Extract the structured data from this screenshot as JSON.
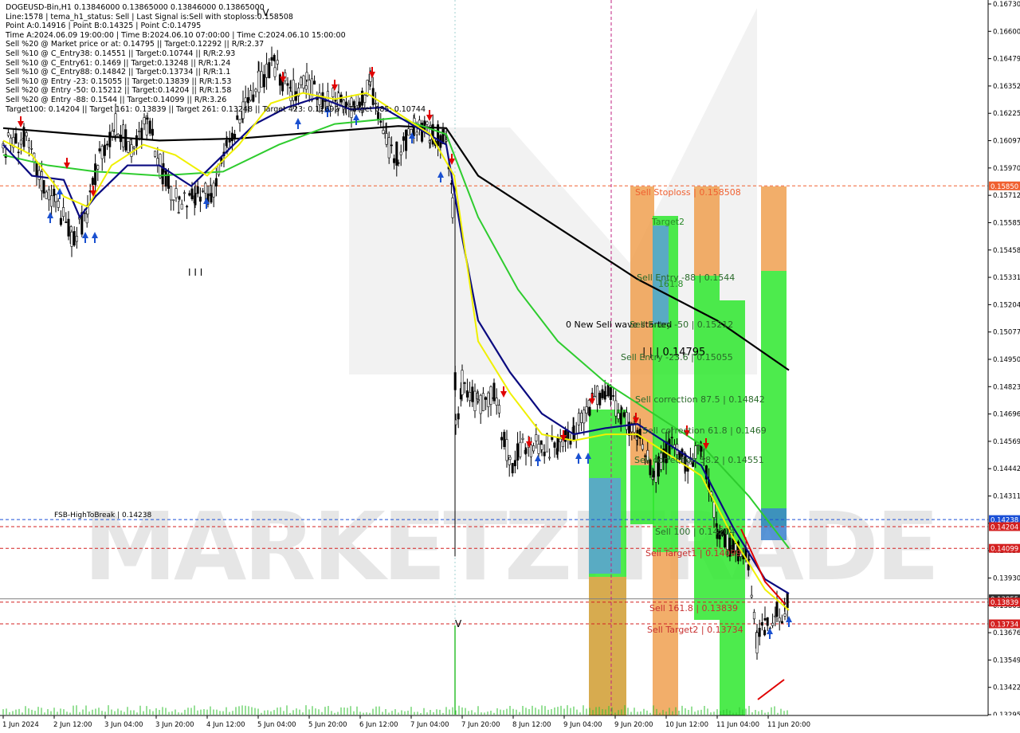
{
  "app": {
    "watermark": "MARKETZITRADE"
  },
  "info_lines": [
    "DOGEUSD-Bin,H1  0.13846000 0.13865000 0.13846000 0.13865000",
    "Line:1578 | tema_h1_status: Sell | Last Signal is:Sell with stoploss:0.158508",
    "Point A:0.14916 | Point B:0.14325 | Point C:0.14795",
    "Time A:2024.06.09 19:00:00 | Time B:2024.06.10 07:00:00 | Time C:2024.06.10 15:00:00",
    "Sell %20 @ Market price or at: 0.14795 || Target:0.12292 || R/R:2.37",
    "Sell %10 @ C_Entry38: 0.14551 || Target:0.10744 || R/R:2.93",
    "Sell %10 @ C_Entry61: 0.1469 || Target:0.13248 || R/R:1.24",
    "Sell %10 @ C_Entry88: 0.14842 || Target:0.13734 || R/R:1.1",
    "Sell %10 @ Entry -23: 0.15055 || Target:0.13839 || R/R:1.53",
    "Sell %20 @ Entry -50: 0.15212 || Target:0.14204 || R/R:1.58",
    "Sell %20 @ Entry -88: 0.1544 || Target:0.14099 || R/R:3.26",
    "Target100: 0.14204 || Target 161: 0.13839 || Target 261: 0.13248 || Target 423: 0.12692 || Target 685: 0.10744"
  ],
  "chart_data": {
    "type": "candlestick",
    "symbol": "DOGEUSD-Bin",
    "timeframe": "H1",
    "ylim": [
      0.13295,
      0.1673
    ],
    "price_axis": {
      "ticks": [
        "0.16730",
        "0.16600",
        "0.16479",
        "0.16352",
        "0.16225",
        "0.16097",
        "0.15970",
        "0.15712",
        "0.15585",
        "0.15458",
        "0.15331",
        "0.15204",
        "0.15077",
        "0.14950",
        "0.14823",
        "0.14696",
        "0.14569",
        "0.14442",
        "0.14311",
        "0.14184",
        "0.14057",
        "0.13930",
        "0.13803",
        "0.13676",
        "0.13549",
        "0.13422",
        "0.13295"
      ],
      "tagged_labels": [
        {
          "text": "0.15850",
          "color": "#f06030"
        },
        {
          "text": "0.14238",
          "color": "#1a4fd6"
        },
        {
          "text": "0.14204",
          "color": "#d42020"
        },
        {
          "text": "0.14099",
          "color": "#d42020"
        },
        {
          "text": "0.13855",
          "color": "#303030"
        },
        {
          "text": "0.13839",
          "color": "#d42020"
        },
        {
          "text": "0.13734",
          "color": "#d42020"
        }
      ]
    },
    "time_axis": [
      "1 Jun 2024",
      "2 Jun 12:00",
      "3 Jun 04:00",
      "3 Jun 20:00",
      "4 Jun 12:00",
      "5 Jun 04:00",
      "5 Jun 20:00",
      "6 Jun 12:00",
      "7 Jun 04:00",
      "7 Jun 20:00",
      "8 Jun 12:00",
      "9 Jun 04:00",
      "9 Jun 20:00",
      "10 Jun 12:00",
      "11 Jun 04:00",
      "11 Jun 20:00"
    ],
    "levels": [
      {
        "name": "Sell Stoploss | 0.158508",
        "price": 0.158508,
        "color": "#f06030"
      },
      {
        "name": "FSB-HighToBreak | 0.14238",
        "price": 0.14238,
        "color": "#1a4fd6"
      },
      {
        "name": "Sell 100 | 0.14204",
        "price": 0.14204,
        "color": "#d42020"
      },
      {
        "name": "Sell Target1 | 0.14099",
        "price": 0.14099,
        "color": "#d42020"
      },
      {
        "name": "Sell 161.8 | 0.13839",
        "price": 0.13839,
        "color": "#d42020"
      },
      {
        "name": "Sell Target2 | 0.13734",
        "price": 0.13734,
        "color": "#d42020"
      }
    ],
    "labels": [
      {
        "text": "Sell Stoploss | 0.158508",
        "color": "#f06030"
      },
      {
        "text": "Target2",
        "color": "#2a8a2a"
      },
      {
        "text": "Sell Entry -88 | 0.1544",
        "color": "#2a6a2a"
      },
      {
        "text": "161.8",
        "color": "#2a8a2a"
      },
      {
        "text": "0 New Sell wave started",
        "color": "#000000"
      },
      {
        "text": "Sell Entry -50 | 0.15212",
        "color": "#2a6a2a"
      },
      {
        "text": "| | | 0.14795",
        "color": "#000000"
      },
      {
        "text": "Sell Entry -23.6 | 0.15055",
        "color": "#2a6a2a"
      },
      {
        "text": "Sell correction 87.5 | 0.14842",
        "color": "#2a6a2a"
      },
      {
        "text": "Sell correction 61.8 | 0.1469",
        "color": "#2a6a2a"
      },
      {
        "text": "Sell correction 38.2 | 0.14551",
        "color": "#2a6a2a"
      },
      {
        "text": "Sell 100 | 0.14204",
        "color": "#2a6a2a"
      },
      {
        "text": "Sell Target1 | 0.14099",
        "color": "#c83030"
      },
      {
        "text": "Sell 161.8 | 0.13839",
        "color": "#c83030"
      },
      {
        "text": "Sell Target2 | 0.13734",
        "color": "#c83030"
      },
      {
        "text": "FSB-HighToBreak | 0.14238",
        "color": "#000000"
      }
    ],
    "wave_marks": [
      "I V",
      "I I I",
      "V"
    ],
    "colors": {
      "up_candle": "#000000",
      "down_candle": "#000000",
      "ma_black": "#000000",
      "ma_green": "#2ecc2e",
      "ma_navy": "#0a0a80",
      "ma_yellow": "#f0f000",
      "sell_arrow": "#e00000",
      "buy_arrow": "#1a50d0"
    }
  }
}
